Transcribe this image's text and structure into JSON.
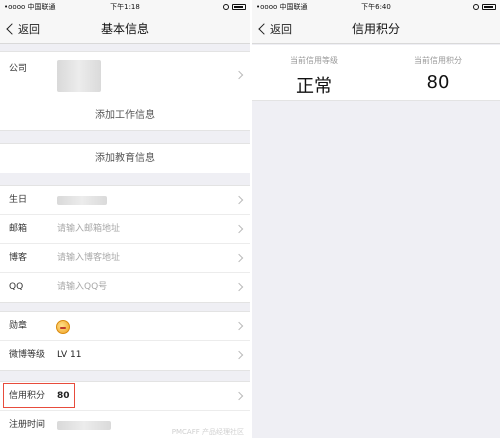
{
  "left_screen": {
    "status": {
      "carrier": "•oooo 中国联通",
      "time": "下午1:18"
    },
    "nav": {
      "back": "返回",
      "title": "基本信息"
    },
    "company": {
      "label": "公司"
    },
    "add_work": "添加工作信息",
    "add_education": "添加教育信息",
    "contact": {
      "birthday_label": "生日",
      "email_label": "邮箱",
      "email_placeholder": "请输入邮箱地址",
      "blog_label": "博客",
      "blog_placeholder": "请输入博客地址",
      "qq_label": "QQ",
      "qq_placeholder": "请输入QQ号"
    },
    "medal": {
      "label": "勋章",
      "icon": "medal-icon"
    },
    "weibo_level": {
      "label": "微博等级",
      "value": "LV 11"
    },
    "credit": {
      "label": "信用积分",
      "value": "80"
    },
    "register": {
      "label": "注册时间"
    }
  },
  "right_screen": {
    "status": {
      "carrier": "•oooo 中国联通",
      "time": "下午6:40"
    },
    "nav": {
      "back": "返回",
      "title": "信用积分"
    },
    "current_level": {
      "label": "当前信用等级",
      "value": "正常"
    },
    "current_score": {
      "label": "当前信用积分",
      "value": "80"
    }
  },
  "watermark": "PMCAFF 产品经理社区",
  "colors": {
    "highlight": "#e74c3c",
    "background": "#efeff4"
  }
}
